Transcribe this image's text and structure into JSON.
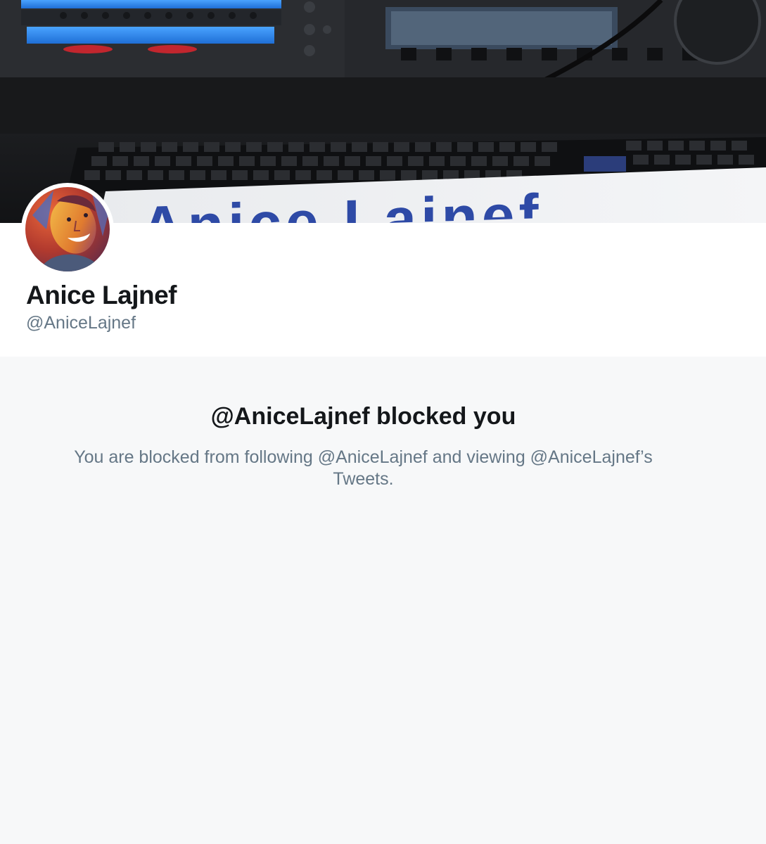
{
  "profile": {
    "display_name": "Anice Lajnef",
    "screen_name": "@AniceLajnef"
  },
  "banner": {
    "visible_text": "Anice Lajnef"
  },
  "blocked_notice": {
    "title": "@AniceLajnef blocked you",
    "body": "You are blocked from following @AniceLajnef and viewing @AniceLajnef’s Tweets."
  },
  "colors": {
    "primary_text": "#14171a",
    "secondary_text": "#657786",
    "page_background": "#f7f8f9",
    "card_background": "#ffffff"
  }
}
